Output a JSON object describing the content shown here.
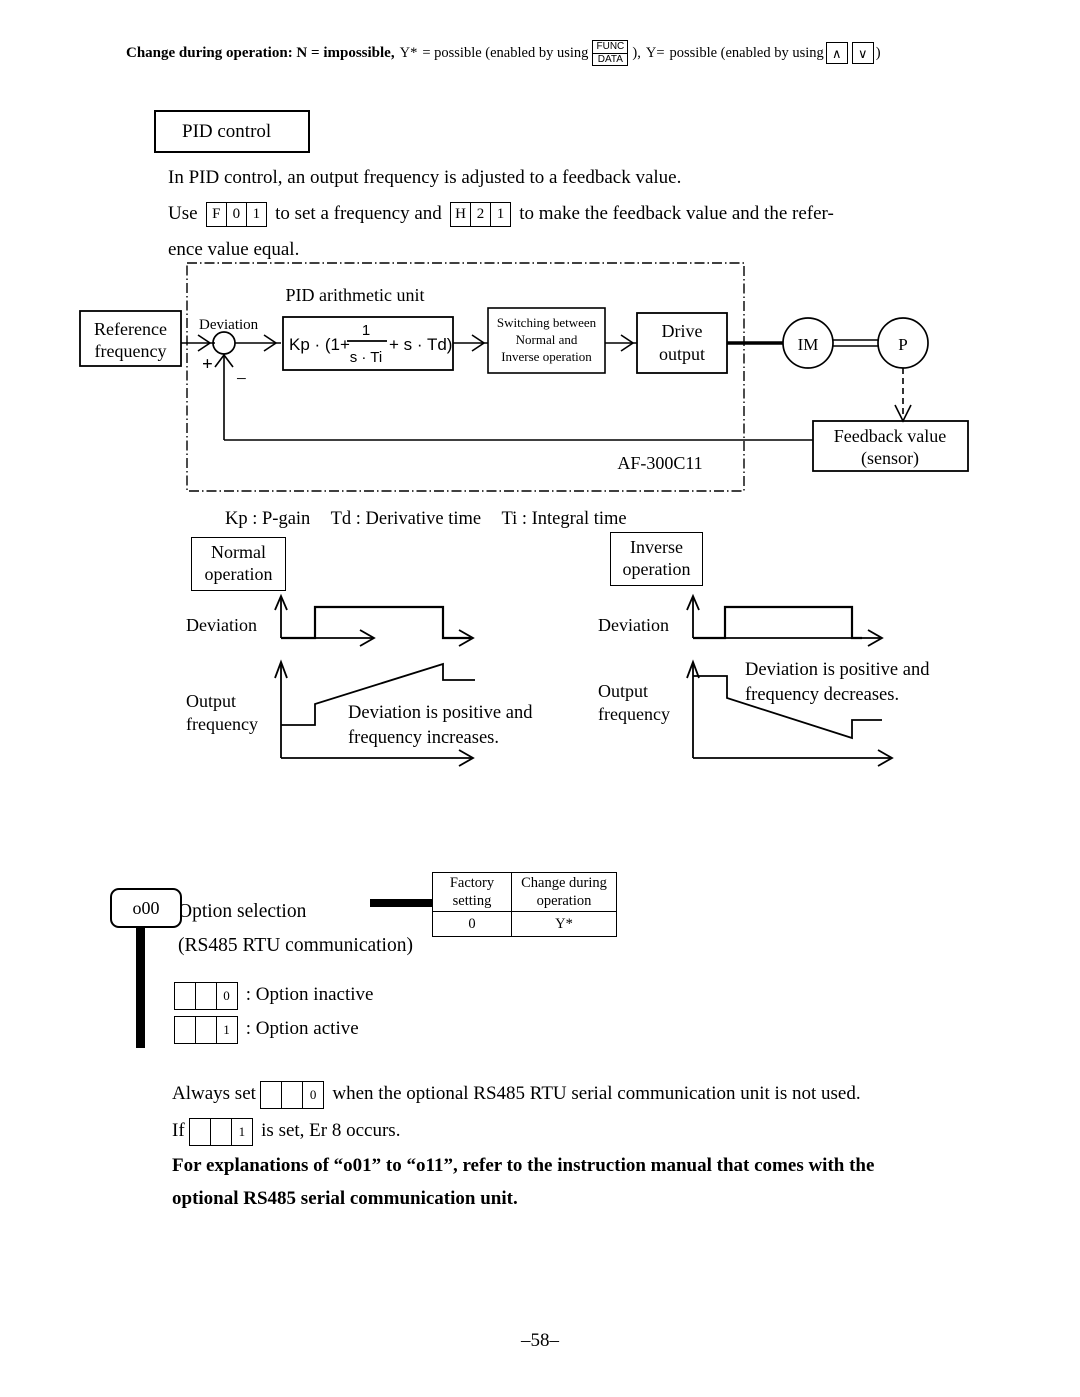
{
  "header": {
    "prefix_bold": "Change during operation: N = impossible,",
    "y_star_label": "Y*",
    "mid_1": "= possible (enabled by using",
    "func_key_top": "FUNC",
    "func_key_bottom": "DATA",
    "mid_2": "),",
    "y_label": "Y=",
    "mid_3": "possible (enabled by using",
    "up_key": "∧",
    "down_key": "∨",
    "suffix": ")"
  },
  "section": {
    "title": "PID control",
    "intro_line1": "In PID control, an output frequency is adjusted to a feedback value.",
    "intro_use": "Use",
    "code_f01": [
      "F",
      "0",
      "1"
    ],
    "intro_mid": "to set a frequency and",
    "code_h21": [
      "H",
      "2",
      "1"
    ],
    "intro_tail": "to make the feedback value and the refer-",
    "intro_line3": "ence value equal."
  },
  "diagram": {
    "reference_frequency": [
      "Reference",
      "frequency"
    ],
    "deviation_label": "Deviation",
    "plus_sign": "+",
    "minus_sign": "−",
    "unit_title": "PID arithmetic unit",
    "formula": {
      "lead": "Kp · (1+",
      "numerator": "1",
      "denominator": "s · Ti",
      "tail": "+ s · Td)"
    },
    "switching_box": [
      "Switching between",
      "Normal and",
      "Inverse operation"
    ],
    "drive_output": [
      "Drive",
      "output"
    ],
    "motor_label": "IM",
    "pump_label": "P",
    "feedback_box": [
      "Feedback value",
      "(sensor)"
    ],
    "enclosure_label": "AF-300C11"
  },
  "legend": {
    "kp": "Kp : P-gain",
    "td": "Td : Derivative time",
    "ti": "Ti : Integral time"
  },
  "graphs": {
    "normal": {
      "box_label": [
        "Normal",
        "operation"
      ],
      "deviation_label": "Deviation",
      "output_label": [
        "Output",
        "frequency"
      ],
      "note": [
        "Deviation is positive and",
        "frequency increases."
      ]
    },
    "inverse": {
      "box_label": [
        "Inverse",
        "operation"
      ],
      "deviation_label": "Deviation",
      "output_label": [
        "Output",
        "frequency"
      ],
      "note": [
        "Deviation is positive and",
        "frequency decreases."
      ]
    }
  },
  "option": {
    "code": "o00",
    "title_line1": "Option selection",
    "title_line2": "(RS485 RTU communication)",
    "table": {
      "headers": [
        [
          "Factory",
          "setting"
        ],
        [
          "Change during",
          "operation"
        ]
      ],
      "values": [
        "0",
        "Y*"
      ]
    },
    "choices": [
      {
        "digits": [
          "",
          "",
          "0"
        ],
        "text": ": Option inactive"
      },
      {
        "digits": [
          "",
          "",
          "1"
        ],
        "text": ": Option active"
      }
    ],
    "always_set_pre": "Always set",
    "always_set_digits": [
      "",
      "",
      "0"
    ],
    "always_set_post": "when the optional RS485 RTU serial communication unit is not used.",
    "if_pre": "If",
    "if_digits": [
      "",
      "",
      "1"
    ],
    "if_post": "is set, Er 8 occurs.",
    "bold_note_line1": "For explanations of “o01” to “o11”, refer to the instruction manual that comes with the",
    "bold_note_line2": "optional RS485 serial communication unit."
  },
  "footer": {
    "page_number": "–58–"
  }
}
